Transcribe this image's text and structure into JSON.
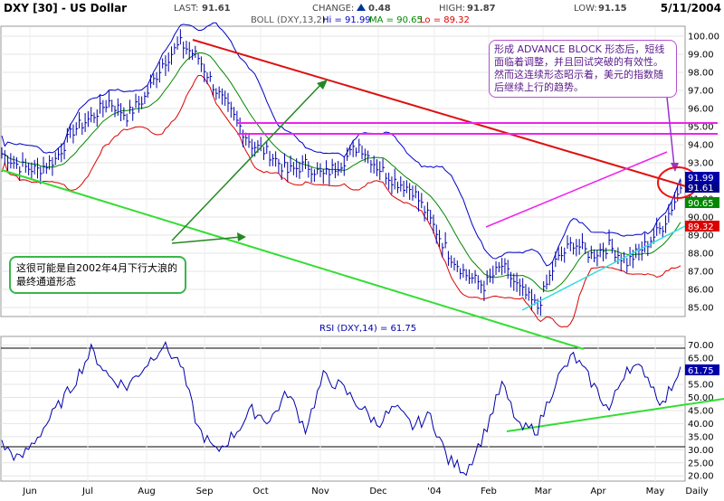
{
  "header": {
    "symbol": "DXY [30] - US Dollar",
    "last_label": "LAST:",
    "last": "91.61",
    "change_label": "CHANGE:",
    "change": "0.48",
    "high_label": "HIGH:",
    "high": "91.87",
    "low_label": "LOW:",
    "low": "91.15",
    "date": "5/11/2004"
  },
  "boll_legend": {
    "label": "BOLL (DXY,13,2)",
    "hi": "Hi = 91.99",
    "ma": "MA = 90.65",
    "lo": "Lo = 89.32"
  },
  "rsi_legend": {
    "label": "RSI (DXY,14) = 61.75"
  },
  "price_badges": {
    "hi": "91.99",
    "last": "91.61",
    "ma": "90.65",
    "lo": "89.32"
  },
  "rsi_badge": "61.75",
  "annotations": {
    "advance_block": "形成 ADVANCE BLOCK 形态后，短线面临着调整，并且回试突破的有效性。然而这连续形态昭示着，美元的指数随后继续上行的趋势。",
    "channel_note": "这很可能是自2002年4月下行大浪的最终通道形态"
  },
  "colors": {
    "price_line": "#0000aa",
    "boll_upper": "#0000cc",
    "boll_lower": "#dd0000",
    "boll_ma": "#008800",
    "red_trend": "#dd1111",
    "green_trend": "#33dd33",
    "magenta": "#ee22ee",
    "cyan": "#33dddd",
    "dark_green_arrow": "#228822",
    "rsi_line": "#0000aa"
  },
  "chart_data": [
    {
      "type": "line",
      "title": "DXY [30] - US Dollar",
      "x_ticks": [
        "Jun",
        "Jul",
        "Aug",
        "Sep",
        "Oct",
        "Nov",
        "Dec",
        "'04",
        "Feb",
        "Mar",
        "Apr",
        "May",
        "Daily"
      ],
      "y_ticks": [
        "85.00",
        "86.00",
        "87.00",
        "88.00",
        "89.00",
        "90.00",
        "91.00",
        "92.00",
        "93.00",
        "94.00",
        "95.00",
        "96.00",
        "97.00",
        "98.00",
        "99.00",
        "100.00"
      ],
      "ylim": [
        84.5,
        100.5
      ],
      "series": [
        {
          "name": "DXY",
          "x": [
            "Jun",
            "Jun",
            "Jun",
            "Jun",
            "Jul",
            "Jul",
            "Jul",
            "Jul",
            "Aug",
            "Aug",
            "Aug",
            "Sep",
            "Sep",
            "Sep",
            "Sep",
            "Oct",
            "Oct",
            "Oct",
            "Oct",
            "Nov",
            "Nov",
            "Nov",
            "Dec",
            "Dec",
            "Dec",
            "'04",
            "'04",
            "'04",
            "Feb",
            "Feb",
            "Feb",
            "Mar",
            "Mar",
            "Mar",
            "Apr",
            "Apr",
            "Apr",
            "May",
            "May"
          ],
          "values": [
            93.5,
            92.8,
            92.6,
            93.2,
            94.8,
            95.5,
            96.4,
            95.6,
            96.6,
            98.5,
            99.6,
            98.8,
            97.0,
            95.5,
            94.0,
            93.5,
            92.5,
            92.9,
            92.3,
            93.0,
            94.0,
            92.8,
            92.0,
            91.5,
            89.8,
            88.0,
            86.8,
            86.2,
            87.3,
            86.0,
            85.0,
            87.5,
            88.6,
            87.9,
            88.4,
            87.5,
            88.4,
            89.5,
            91.6
          ]
        }
      ]
    },
    {
      "type": "line",
      "title": "RSI (DXY,14) = 61.75",
      "x_ticks": [
        "Jun",
        "Jul",
        "Aug",
        "Sep",
        "Oct",
        "Nov",
        "Dec",
        "'04",
        "Feb",
        "Mar",
        "Apr",
        "May",
        "Daily"
      ],
      "y_ticks": [
        "20.00",
        "25.00",
        "30.00",
        "35.00",
        "40.00",
        "45.00",
        "50.00",
        "55.00",
        "60.00",
        "65.00",
        "70.00"
      ],
      "ylim": [
        18,
        73
      ],
      "series": [
        {
          "name": "RSI",
          "x": [
            "Jun",
            "Jun",
            "Jun",
            "Jun",
            "Jul",
            "Jul",
            "Jul",
            "Jul",
            "Aug",
            "Aug",
            "Aug",
            "Sep",
            "Sep",
            "Sep",
            "Sep",
            "Oct",
            "Oct",
            "Oct",
            "Oct",
            "Nov",
            "Nov",
            "Nov",
            "Dec",
            "Dec",
            "Dec",
            "'04",
            "'04",
            "'04",
            "Feb",
            "Feb",
            "Feb",
            "Mar",
            "Mar",
            "Mar",
            "Apr",
            "Apr",
            "Apr",
            "May",
            "May"
          ],
          "values": [
            32,
            26,
            35,
            45,
            55,
            68,
            58,
            54,
            62,
            70,
            63,
            38,
            29,
            36,
            45,
            41,
            52,
            38,
            58,
            54,
            47,
            40,
            46,
            39,
            43,
            26,
            22,
            36,
            55,
            38,
            38,
            56,
            66,
            56,
            45,
            62,
            60,
            47,
            61.75
          ]
        }
      ]
    }
  ]
}
